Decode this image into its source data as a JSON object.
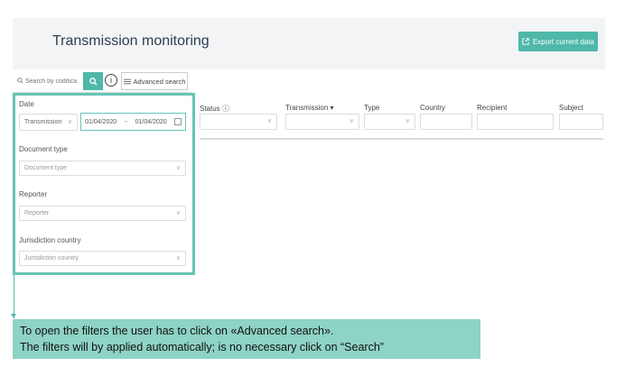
{
  "header": {
    "title": "Transmission monitoring",
    "export_label": "Export current data"
  },
  "search": {
    "placeholder": "Search by codifica",
    "advanced_label": "Advanced search",
    "info_symbol": "i"
  },
  "filters": {
    "date_label": "Date",
    "date_type_value": "Transmission",
    "date_from": "01/04/2020",
    "date_separator": "~",
    "date_to": "01/04/2020",
    "document_type_label": "Document type",
    "document_type_placeholder": "Document type",
    "reporter_label": "Reporter",
    "reporter_placeholder": "Reporter",
    "jurisdiction_label": "Jurisdiction country",
    "jurisdiction_placeholder": "Jurisdiction country"
  },
  "table": {
    "columns": [
      "Status ⓘ",
      "Transmission ▾",
      "Type",
      "Country",
      "Recipient",
      "Subject"
    ]
  },
  "note": {
    "line1": "To open the filters the user has to click on «Advanced search».",
    "line2": "The filters will by applied automatically; is no necessary click on “Search”"
  },
  "colors": {
    "accent": "#4fb8a9",
    "highlight_border": "#67c4b6",
    "note_background": "#8ed3c5"
  },
  "icons": [
    "external-link-icon",
    "search-icon",
    "info-icon",
    "menu-icon",
    "chevron-down-icon",
    "calendar-icon",
    "sort-caret-icon"
  ]
}
